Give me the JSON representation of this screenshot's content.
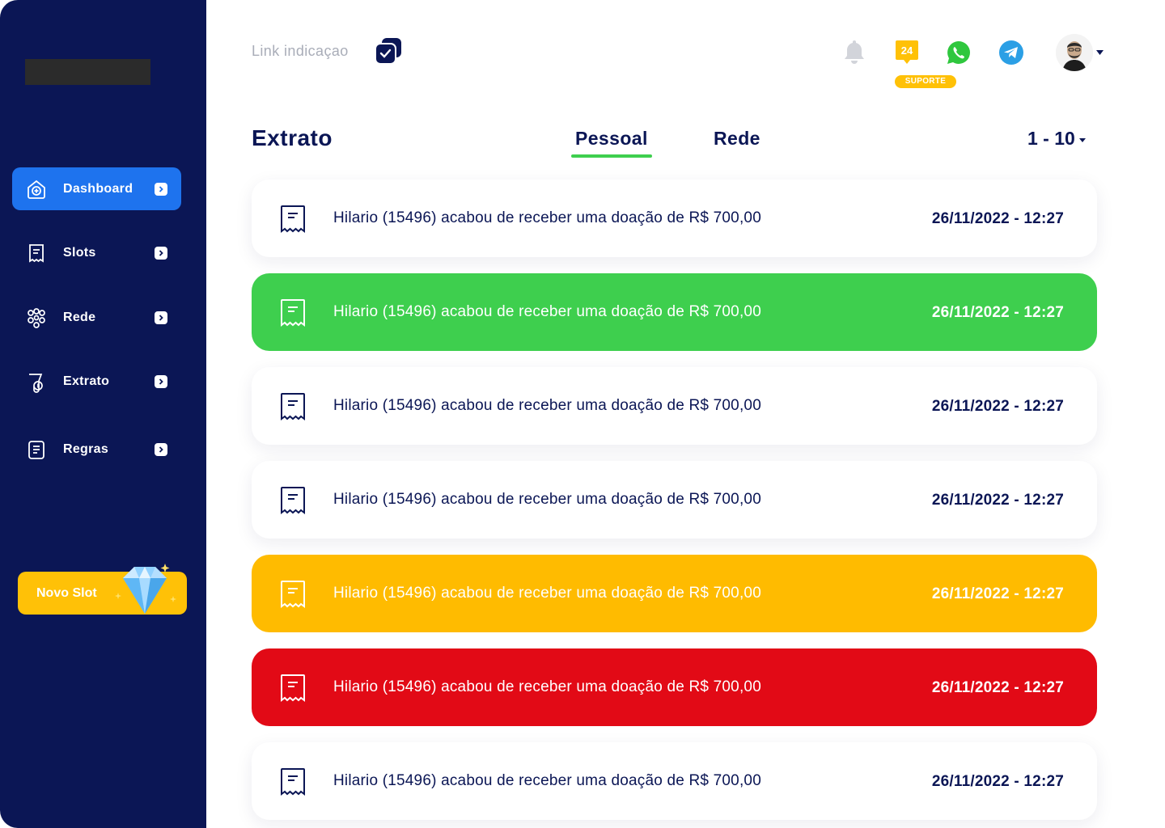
{
  "sidebar": {
    "items": [
      {
        "label": "Dashboard",
        "icon": "home-icon",
        "active": true
      },
      {
        "label": "Slots",
        "icon": "receipt-icon"
      },
      {
        "label": "Rede",
        "icon": "network-icon"
      },
      {
        "label": "Extrato",
        "icon": "wallet-icon"
      },
      {
        "label": "Regras",
        "icon": "document-icon"
      }
    ],
    "novo_slot_label": "Novo Slot"
  },
  "topbar": {
    "link_indicacao": "Link indicaçao",
    "support_badge": "SUPORTE",
    "support_number": "24"
  },
  "header": {
    "title": "Extrato",
    "tabs": [
      {
        "label": "Pessoal",
        "active": true
      },
      {
        "label": "Rede",
        "active": false
      }
    ],
    "pager": "1 - 10"
  },
  "colors": {
    "sidebar": "#0b1655",
    "accent_blue": "#1e73ee",
    "green": "#3ecf4e",
    "yellow": "#ffbb00",
    "red": "#e20a16",
    "text_dark": "#0b1655"
  },
  "transactions": [
    {
      "message": "Hilario (15496) acabou de receber uma doação de R$ 700,00",
      "date": "26/11/2022 - 12:27",
      "status": "default"
    },
    {
      "message": "Hilario (15496) acabou de receber uma doação de R$ 700,00",
      "date": "26/11/2022 - 12:27",
      "status": "green"
    },
    {
      "message": "Hilario (15496) acabou de receber uma doação de R$ 700,00",
      "date": "26/11/2022 - 12:27",
      "status": "default"
    },
    {
      "message": "Hilario (15496) acabou de receber uma doação de R$ 700,00",
      "date": "26/11/2022 - 12:27",
      "status": "default"
    },
    {
      "message": "Hilario (15496) acabou de receber uma doação de R$ 700,00",
      "date": "26/11/2022 - 12:27",
      "status": "yellow"
    },
    {
      "message": "Hilario (15496) acabou de receber uma doação de R$ 700,00",
      "date": "26/11/2022 - 12:27",
      "status": "red"
    },
    {
      "message": "Hilario (15496) acabou de receber uma doação de R$ 700,00",
      "date": "26/11/2022 - 12:27",
      "status": "default"
    }
  ]
}
